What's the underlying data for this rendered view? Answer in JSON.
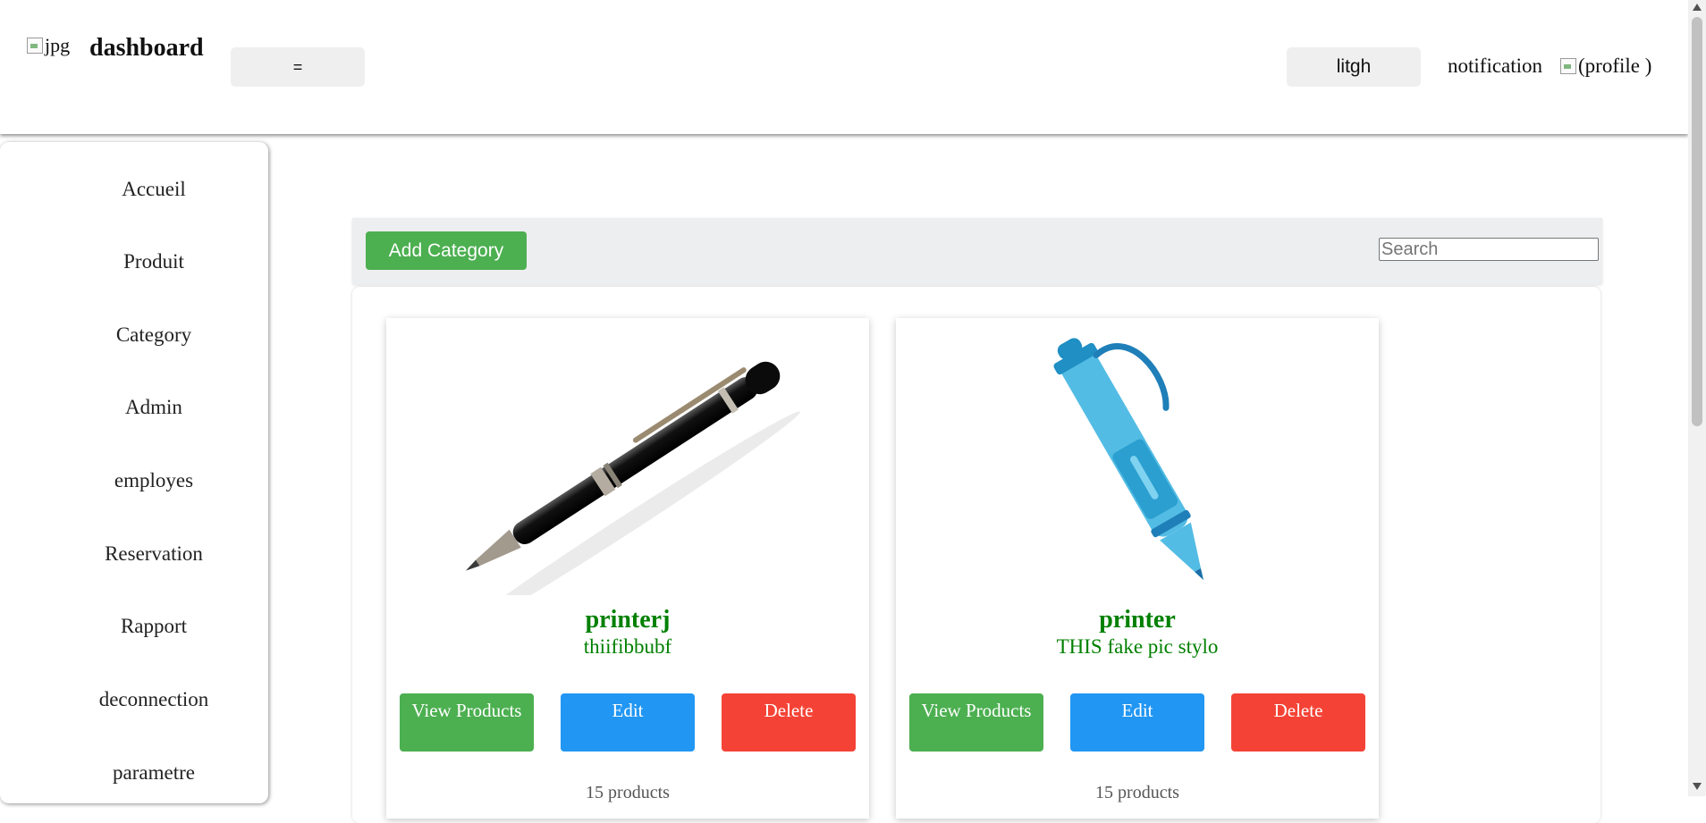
{
  "header": {
    "logo_alt": "jpg",
    "brand": "dashboard",
    "menu_toggle_label": "=",
    "theme_button_label": "litgh",
    "notification_label": "notification",
    "profile_alt": "(profile )"
  },
  "sidebar": {
    "items": [
      {
        "label": "Accueil"
      },
      {
        "label": "Produit"
      },
      {
        "label": "Category"
      },
      {
        "label": "Admin"
      },
      {
        "label": "employes"
      },
      {
        "label": "Reservation"
      },
      {
        "label": "Rapport"
      },
      {
        "label": "deconnection"
      },
      {
        "label": "parametre"
      }
    ]
  },
  "toolbar": {
    "add_label": "Add Category",
    "search_placeholder": "Search"
  },
  "categories": [
    {
      "name": "printerj",
      "description": "thiifibbubf",
      "image": "black-ballpoint-pen-photo",
      "view_label": "View Products",
      "edit_label": "Edit",
      "delete_label": "Delete",
      "count": "15 products"
    },
    {
      "name": "printer",
      "description": "THIS fake pic stylo",
      "image": "blue-pen-illustration",
      "view_label": "View Products",
      "edit_label": "Edit",
      "delete_label": "Delete",
      "count": "15 products"
    }
  ],
  "colors": {
    "accent_green": "#4caf50",
    "accent_blue": "#2196f3",
    "accent_red": "#f44336",
    "text_green": "#008000"
  }
}
